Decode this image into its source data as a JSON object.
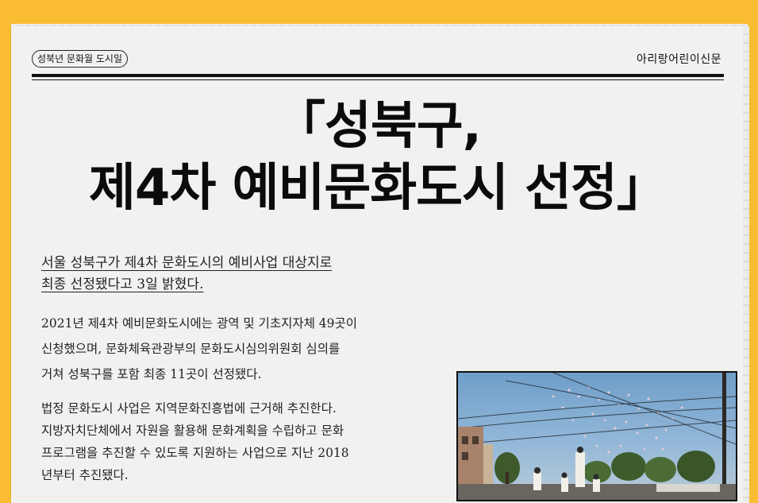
{
  "header": {
    "tag": "성북년 문화월 도시일",
    "brand": "아리랑어린이신문"
  },
  "headline": {
    "line1": "「성북구,",
    "line2": "제4차 예비문화도시 선정」"
  },
  "lead": {
    "line1": "서울 성북구가 제4차 문화도시의 예비사업 대상지로",
    "line2": "최종 선정됐다고 3일 밝혔다."
  },
  "body": {
    "p1": [
      "2021년 제4차 예비문화도시에는 광역 및 기초지자체 49곳이",
      "신청했으며, 문화체육관광부의 문화도시심의위원회 심의를",
      "거쳐 성북구를 포함 최종 11곳이 선정됐다."
    ],
    "p2": [
      "법정 문화도시 사업은 지역문화진흥법에 근거해 추진한다.",
      "지방자치단체에서 자원을 활용해 문화계획을 수립하고  문화",
      "프로그램을 추진할 수 있도록 지원하는 사업으로  지난 2018",
      "년부터 추진됐다."
    ]
  },
  "photo": {
    "sky_color": "#7fa8cf"
  }
}
